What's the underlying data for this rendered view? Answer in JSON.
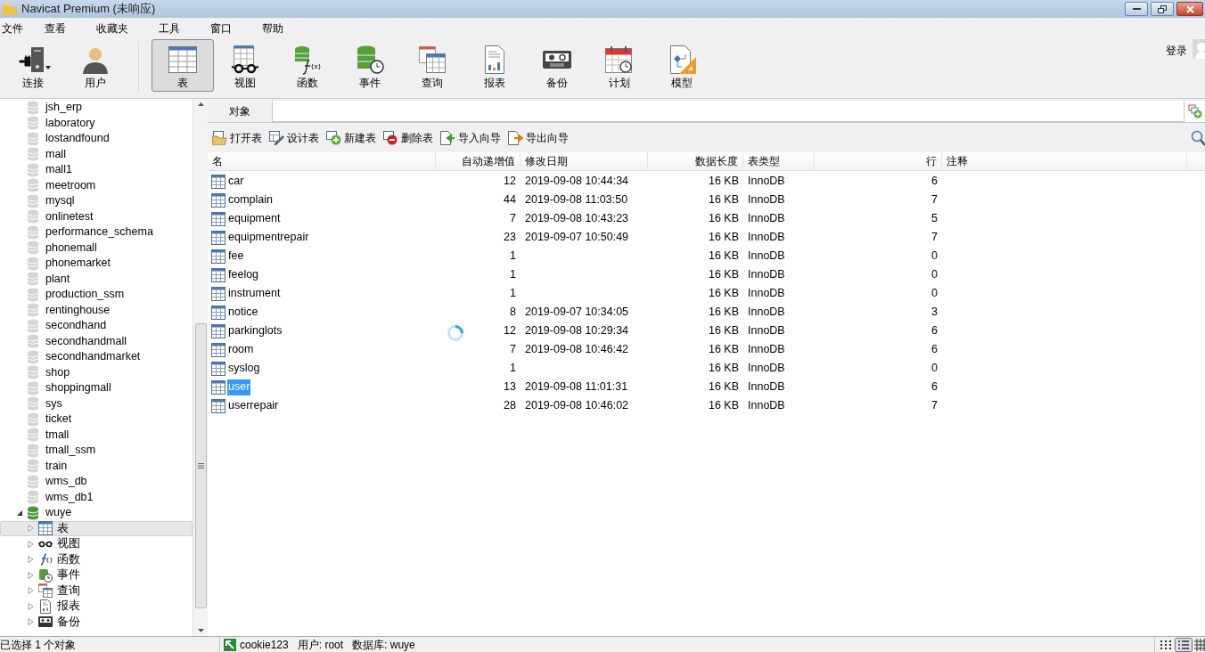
{
  "window": {
    "title": "Navicat Premium (未响应)"
  },
  "menu": [
    "文件",
    "查看",
    "收藏夹",
    "工具",
    "窗口",
    "帮助"
  ],
  "toolbar": {
    "left": [
      {
        "kind": "connection",
        "label": "连接",
        "selected": false
      },
      {
        "kind": "user",
        "label": "用户",
        "selected": false
      }
    ],
    "objects": [
      {
        "kind": "table",
        "label": "表",
        "selected": true
      },
      {
        "kind": "view",
        "label": "视图",
        "selected": false
      },
      {
        "kind": "function",
        "label": "函数",
        "selected": false
      },
      {
        "kind": "event",
        "label": "事件",
        "selected": false
      },
      {
        "kind": "query",
        "label": "查询",
        "selected": false
      },
      {
        "kind": "report",
        "label": "报表",
        "selected": false
      },
      {
        "kind": "backup",
        "label": "备份",
        "selected": false
      },
      {
        "kind": "schedule",
        "label": "计划",
        "selected": false
      },
      {
        "kind": "model",
        "label": "模型",
        "selected": false
      }
    ],
    "login": "登录"
  },
  "sidebar": {
    "items": [
      {
        "label": "jsh_erp"
      },
      {
        "label": "laboratory"
      },
      {
        "label": "lostandfound"
      },
      {
        "label": "mall"
      },
      {
        "label": "mall1"
      },
      {
        "label": "meetroom"
      },
      {
        "label": "mysql"
      },
      {
        "label": "onlinetest"
      },
      {
        "label": "performance_schema"
      },
      {
        "label": "phonemall"
      },
      {
        "label": "phonemarket"
      },
      {
        "label": "plant"
      },
      {
        "label": "production_ssm"
      },
      {
        "label": "rentinghouse"
      },
      {
        "label": "secondhand"
      },
      {
        "label": "secondhandmall"
      },
      {
        "label": "secondhandmarket"
      },
      {
        "label": "shop"
      },
      {
        "label": "shoppingmall"
      },
      {
        "label": "sys"
      },
      {
        "label": "ticket"
      },
      {
        "label": "tmall"
      },
      {
        "label": "tmall_ssm"
      },
      {
        "label": "train"
      },
      {
        "label": "wms_db"
      },
      {
        "label": "wms_db1"
      },
      {
        "label": "wuye",
        "expanded": true,
        "children": [
          {
            "kind": "table",
            "label": "表",
            "selected": true,
            "expanded": false
          },
          {
            "kind": "view",
            "label": "视图",
            "selected": false,
            "expanded": false
          },
          {
            "kind": "function",
            "label": "函数",
            "selected": false,
            "expanded": false
          },
          {
            "kind": "event",
            "label": "事件",
            "selected": false,
            "expanded": false
          },
          {
            "kind": "query",
            "label": "查询",
            "selected": false,
            "expanded": false
          },
          {
            "kind": "report",
            "label": "报表",
            "selected": false,
            "expanded": false
          },
          {
            "kind": "backup",
            "label": "备份",
            "selected": false,
            "expanded": false
          }
        ]
      }
    ]
  },
  "tabs": [
    {
      "label": "对象",
      "selected": true
    }
  ],
  "actions": [
    {
      "kind": "open",
      "label": "打开表"
    },
    {
      "kind": "design",
      "label": "设计表"
    },
    {
      "kind": "new",
      "label": "新建表"
    },
    {
      "kind": "delete",
      "label": "删除表"
    },
    {
      "kind": "import",
      "label": "导入向导"
    },
    {
      "kind": "export",
      "label": "导出向导"
    }
  ],
  "table": {
    "columns": [
      "名",
      "自动递增值",
      "修改日期",
      "数据长度",
      "表类型",
      "行",
      "注释"
    ],
    "rows": [
      {
        "name": "car",
        "auto_increment": "12",
        "modified": "2019-09-08 10:44:34",
        "data_length": "16 KB",
        "engine": "InnoDB",
        "rows": "6",
        "selected": false
      },
      {
        "name": "complain",
        "auto_increment": "44",
        "modified": "2019-09-08 11:03:50",
        "data_length": "16 KB",
        "engine": "InnoDB",
        "rows": "7",
        "selected": false
      },
      {
        "name": "equipment",
        "auto_increment": "7",
        "modified": "2019-09-08 10:43:23",
        "data_length": "16 KB",
        "engine": "InnoDB",
        "rows": "5",
        "selected": false
      },
      {
        "name": "equipmentrepair",
        "auto_increment": "23",
        "modified": "2019-09-07 10:50:49",
        "data_length": "16 KB",
        "engine": "InnoDB",
        "rows": "7",
        "selected": false
      },
      {
        "name": "fee",
        "auto_increment": "1",
        "data_length": "16 KB",
        "engine": "InnoDB",
        "rows": "0",
        "selected": false
      },
      {
        "name": "feelog",
        "auto_increment": "1",
        "data_length": "16 KB",
        "engine": "InnoDB",
        "rows": "0",
        "selected": false
      },
      {
        "name": "instrument",
        "auto_increment": "1",
        "data_length": "16 KB",
        "engine": "InnoDB",
        "rows": "0",
        "selected": false
      },
      {
        "name": "notice",
        "auto_increment": "8",
        "modified": "2019-09-07 10:34:05",
        "data_length": "16 KB",
        "engine": "InnoDB",
        "rows": "3",
        "selected": false
      },
      {
        "name": "parkinglots",
        "auto_increment": "12",
        "modified": "2019-09-08 10:29:34",
        "data_length": "16 KB",
        "engine": "InnoDB",
        "rows": "6",
        "selected": false
      },
      {
        "name": "room",
        "auto_increment": "7",
        "modified": "2019-09-08 10:46:42",
        "data_length": "16 KB",
        "engine": "InnoDB",
        "rows": "6",
        "selected": false
      },
      {
        "name": "syslog",
        "auto_increment": "1",
        "data_length": "16 KB",
        "engine": "InnoDB",
        "rows": "0",
        "selected": false
      },
      {
        "name": "user",
        "auto_increment": "13",
        "modified": "2019-09-08 11:01:31",
        "data_length": "16 KB",
        "engine": "InnoDB",
        "rows": "6",
        "selected": true
      },
      {
        "name": "userrepair",
        "auto_increment": "28",
        "modified": "2019-09-08 10:46:02",
        "data_length": "16 KB",
        "engine": "InnoDB",
        "rows": "7",
        "selected": false
      }
    ]
  },
  "status_bar": {
    "selection": "已选择 1 个对象",
    "connection": "cookie123",
    "user": "用户: root",
    "database": "数据库: wuye"
  }
}
